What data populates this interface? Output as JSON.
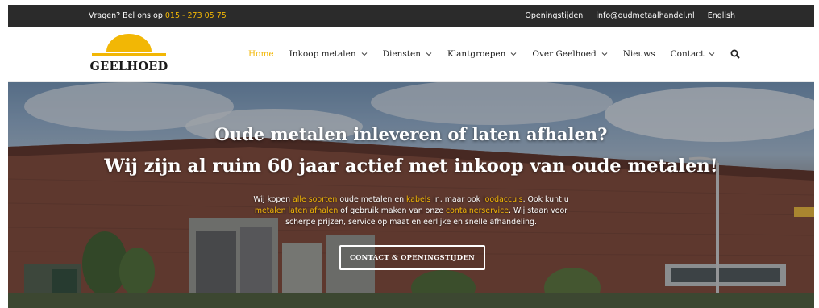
{
  "topbar": {
    "call_prefix": "Vragen? Bel ons op",
    "phone": "015 - 273 05 75",
    "links": [
      "Openingstijden",
      "info@oudmetaalhandel.nl",
      "English"
    ]
  },
  "header": {
    "logo_text": "GEELHOED",
    "nav": [
      {
        "label": "Home",
        "active": true,
        "dropdown": false
      },
      {
        "label": "Inkoop metalen",
        "active": false,
        "dropdown": true
      },
      {
        "label": "Diensten",
        "active": false,
        "dropdown": true
      },
      {
        "label": "Klantgroepen",
        "active": false,
        "dropdown": true
      },
      {
        "label": "Over Geelhoed",
        "active": false,
        "dropdown": true
      },
      {
        "label": "Nieuws",
        "active": false,
        "dropdown": false
      },
      {
        "label": "Contact",
        "active": false,
        "dropdown": true
      }
    ],
    "search_icon": "search-icon"
  },
  "hero": {
    "title_line1": "Oude metalen inleveren of laten afhalen?",
    "title_line2": "Wij zijn al ruim 60 jaar actief met inkoop van oude metalen!",
    "text": {
      "p1": "Wij kopen ",
      "l1": "alle soorten",
      "p2": " oude metalen en ",
      "l2": "kabels",
      "p3": " in, maar ook ",
      "l3": "loodaccu's",
      "p4": ". Ook kunt u ",
      "l4": "metalen laten afhalen",
      "p5": " of gebruik maken van onze ",
      "l5": "containerservice",
      "p6": ". Wij staan voor scherpe prijzen, service op maat en eerlijke en snelle afhandeling."
    },
    "button_label": "CONTACT & OPENINGSTIJDEN"
  },
  "colors": {
    "accent": "#f2b705",
    "topbar_bg": "#2b2b2b",
    "text_dark": "#222222"
  }
}
